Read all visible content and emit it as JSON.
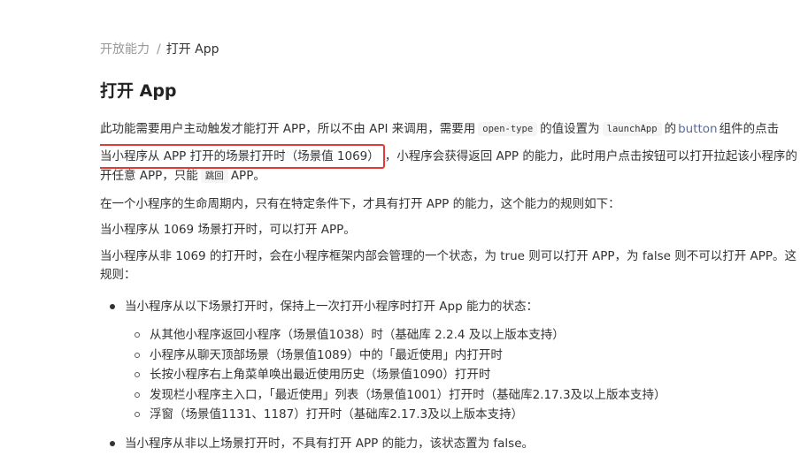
{
  "breadcrumb": {
    "parent": "开放能力",
    "separator": "/",
    "current": "打开 App"
  },
  "title": "打开 App",
  "intro": {
    "part1": "此功能需要用户主动触发才能打开 APP，所以不由 API 来调用，需要用",
    "code1": "open-type",
    "part2": "的值设置为",
    "code2": "launchApp",
    "part3": "的",
    "link": "button",
    "part4": "组件的点击"
  },
  "scene": {
    "highlighted": "当小程序从 APP 打开的场景打开时（场景值 1069）",
    "rest": "，小程序会获得返回 APP 的能力，此时用户点击按钮可以打开拉起该小程序的",
    "line2_part1": "开任意 APP，只能",
    "line2_code": "跳回",
    "line2_part2": "APP。"
  },
  "para_lifecycle": "在一个小程序的生命周期内，只有在特定条件下，才具有打开 APP 的能力，这个能力的规则如下：",
  "para_1069": "当小程序从 1069 场景打开时，可以打开 APP。",
  "para_non1069": {
    "line1": "当小程序从非 1069 的打开时，会在小程序框架内部会管理的一个状态，为 true 则可以打开 APP，为 false 则不可以打开 APP。这",
    "line2": "规则："
  },
  "bullets": [
    {
      "text": "当小程序从以下场景打开时，保持上一次打开小程序时打开 App 能力的状态：",
      "sub": [
        "从其他小程序返回小程序（场景值1038）时（基础库 2.2.4 及以上版本支持）",
        "小程序从聊天顶部场景（场景值1089）中的「最近使用」内打开时",
        "长按小程序右上角菜单唤出最近使用历史（场景值1090）打开时",
        "发现栏小程序主入口，「最近使用」列表（场景值1001）打开时（基础库2.17.3及以上版本支持）",
        "浮窗（场景值1131、1187）打开时（基础库2.17.3及以上版本支持）"
      ]
    },
    {
      "text": "当小程序从非以上场景打开时，不具有打开 APP 的能力，该状态置为 false。"
    }
  ]
}
